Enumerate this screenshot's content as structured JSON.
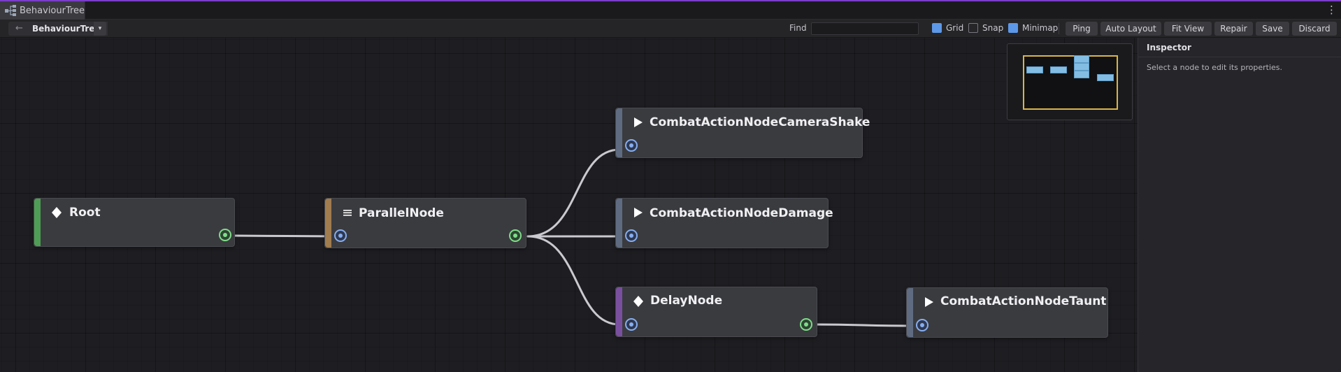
{
  "tab": {
    "title": "BehaviourTree",
    "icon": "behaviour-tree-icon"
  },
  "toolbar": {
    "back_glyph": "←",
    "breadcrumb": "BehaviourTree",
    "dropdown_glyph": "▾",
    "find_label": "Find",
    "find_value": "",
    "toggles": [
      {
        "label": "Grid",
        "checked": true
      },
      {
        "label": "Snap",
        "checked": false
      },
      {
        "label": "Minimap",
        "checked": true
      }
    ],
    "buttons": [
      "Ping",
      "Auto Layout",
      "Fit View",
      "Repair",
      "Save",
      "Discard"
    ],
    "menu_glyph": "⋮"
  },
  "graph": {
    "nodes": [
      {
        "id": "root",
        "title": "Root",
        "glyph": "diamond",
        "stripe_color": "#4f9e55"
      },
      {
        "id": "parallel",
        "title": "ParallelNode",
        "glyph": "menu",
        "stripe_color": "#a07c4e"
      },
      {
        "id": "camera_shake",
        "title": "CombatActionNodeCameraShake",
        "glyph": "play",
        "stripe_color": "#5f6b80"
      },
      {
        "id": "damage",
        "title": "CombatActionNodeDamage",
        "glyph": "play",
        "stripe_color": "#5f6b80"
      },
      {
        "id": "delay",
        "title": "DelayNode",
        "glyph": "diamond",
        "stripe_color": "#7b4fa0"
      },
      {
        "id": "taunt",
        "title": "CombatActionNodeTaunt",
        "glyph": "play",
        "stripe_color": "#5f6b80"
      }
    ],
    "connections": [
      [
        "root",
        "parallel"
      ],
      [
        "parallel",
        "camera_shake"
      ],
      [
        "parallel",
        "damage"
      ],
      [
        "parallel",
        "delay"
      ],
      [
        "delay",
        "taunt"
      ]
    ],
    "colors": {
      "wire": "#c9c9cf",
      "input_port": "#86aef0",
      "output_port": "#7fdc8a",
      "minimap_viewport": "#d9b54a",
      "minimap_node": "#84bde3"
    }
  },
  "inspector": {
    "title": "Inspector",
    "empty_text": "Select a node to edit its properties."
  }
}
